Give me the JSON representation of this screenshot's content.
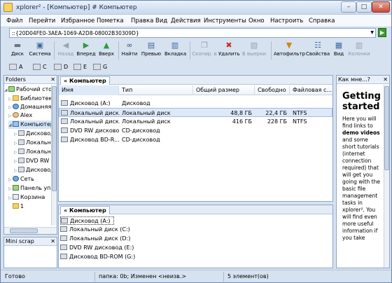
{
  "window": {
    "title": "xplorer² - [Компьютер] # Компьютер"
  },
  "menu": [
    "Файл",
    "Перейти",
    "Избранное",
    "Пометка",
    "Правка",
    "Вид",
    "Действия",
    "Инструменты",
    "Окно",
    "Настроить",
    "Справка"
  ],
  "address": {
    "value": "::{20D04FE0-3AEA-1069-A2D8-08002B30309D}"
  },
  "toolbar": [
    {
      "label": "Диск",
      "icon": "disk-icon",
      "enabled": true
    },
    {
      "label": "Система",
      "icon": "system-icon",
      "enabled": true
    },
    {
      "label": "Назад",
      "icon": "back-icon",
      "enabled": false
    },
    {
      "label": "Вперед",
      "icon": "forward-icon",
      "enabled": true
    },
    {
      "label": "Вверх",
      "icon": "up-icon",
      "enabled": true
    },
    {
      "label": "Найти",
      "icon": "binoculars-icon",
      "enabled": true
    },
    {
      "label": "Превью",
      "icon": "preview-icon",
      "enabled": true
    },
    {
      "label": "Вкладка",
      "icon": "tab-icon",
      "enabled": true
    },
    {
      "label": "Скопир. в",
      "icon": "copy-to-icon",
      "enabled": false
    },
    {
      "label": "Удалить",
      "icon": "delete-icon",
      "enabled": true
    },
    {
      "label": "В выерки",
      "icon": "scrap-icon",
      "enabled": false
    },
    {
      "label": "Автофильтр",
      "icon": "filter-icon",
      "enabled": true
    },
    {
      "label": "Свойства",
      "icon": "properties-icon",
      "enabled": true
    },
    {
      "label": "Вид",
      "icon": "view-icon",
      "enabled": true
    },
    {
      "label": "Колонки",
      "icon": "columns-icon",
      "enabled": false
    }
  ],
  "drives": [
    "A",
    "C",
    "D",
    "E",
    "G"
  ],
  "folders": {
    "header": "Folders",
    "items": [
      {
        "label": "Рабочий стол"
      },
      {
        "label": "Библиотеки"
      },
      {
        "label": "Домашняя"
      },
      {
        "label": "Alex"
      },
      {
        "label": "Компьютер"
      },
      {
        "label": "Дисковод"
      },
      {
        "label": "Локальный"
      },
      {
        "label": "Локальный"
      },
      {
        "label": "DVD RW"
      },
      {
        "label": "Дисковод"
      },
      {
        "label": "Сеть"
      },
      {
        "label": "Панель управления"
      },
      {
        "label": "Корзина"
      },
      {
        "label": "1"
      }
    ]
  },
  "mini_scrap": {
    "header": "Mini scrap"
  },
  "top_pane": {
    "tab": "« Компьютер",
    "columns": [
      "Имя",
      "Тип",
      "Общий размер",
      "Свободно",
      "Файловая с..."
    ],
    "rows": [
      {
        "name": "Дисковод (A:)",
        "type": "Дисковод",
        "size": "",
        "free": "",
        "fs": ""
      },
      {
        "name": "Локальный диск...",
        "type": "Локальный диск",
        "size": "48,8 ГБ",
        "free": "22,4 ГБ",
        "fs": "NTFS"
      },
      {
        "name": "Локальный диск...",
        "type": "Локальный диск",
        "size": "416 ГБ",
        "free": "228 ГБ",
        "fs": "NTFS"
      },
      {
        "name": "DVD RW дисково...",
        "type": "CD-дисковод",
        "size": "",
        "free": "",
        "fs": ""
      },
      {
        "name": "Дисковод BD-R...",
        "type": "CD-дисковод",
        "size": "",
        "free": "",
        "fs": ""
      }
    ]
  },
  "bottom_pane": {
    "tab": "« Компьютер",
    "items": [
      "Дисковод (A:)",
      "Локальный диск (C:)",
      "Локальный диск (D:)",
      "DVD RW дисковод (E:)",
      "Дисковод BD-ROM (G:)"
    ]
  },
  "help": {
    "header": "Как мне...?",
    "title": "Getting started",
    "text_1": "Here you will find links to",
    "bold_1": "demo videos",
    "text_2": "and some short tutorials (internet connection required) that will get you going with the basic file management tasks in xplorer². You will find even more useful information if you take"
  },
  "status": {
    "left": "Готово",
    "middle": "папка: 0b; Изменен <неизв.>",
    "right": "5 элемент(ов)"
  }
}
